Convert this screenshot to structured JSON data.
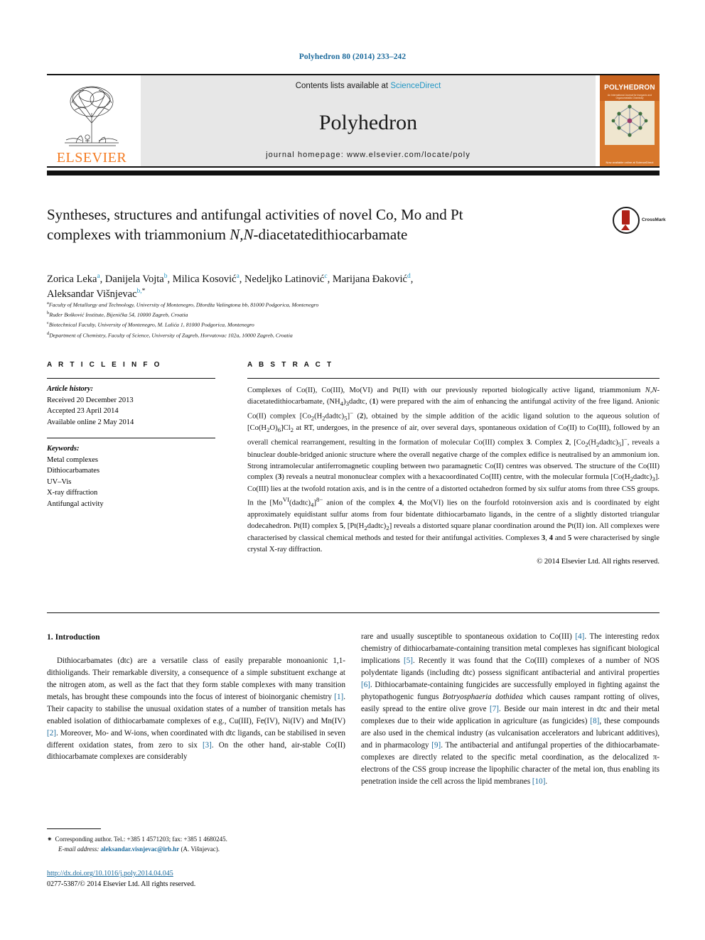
{
  "running_head": "Polyhedron 80 (2014) 233–242",
  "masthead": {
    "contents_prefix": "Contents lists available at ",
    "sciencedirect": "ScienceDirect",
    "journal_name": "Polyhedron",
    "homepage": "journal homepage: www.elsevier.com/locate/poly",
    "publisher_logo_text": "ELSEVIER",
    "cover_title": "POLYHEDRON",
    "cover_subtitle": "An International Journal for Inorganic and Organometallic Chemistry",
    "cover_footer": "Now available online at ScienceDirect"
  },
  "crossmark": {
    "label": "CrossMark"
  },
  "article": {
    "title_line1": "Syntheses, structures and antifungal activities of novel Co, Mo and Pt",
    "title_line2_pre": "complexes with triammonium ",
    "title_line2_italic": "N,N",
    "title_line2_post": "-diacetatedithiocarbamate",
    "authors": [
      {
        "name": "Zorica Leka",
        "sup": "a",
        "sep": ", "
      },
      {
        "name": "Danijela Vojta",
        "sup": "b",
        "sep": ", "
      },
      {
        "name": "Milica Kosović",
        "sup": "a",
        "sep": ", "
      },
      {
        "name": "Nedeljko Latinović",
        "sup": "c",
        "sep": ", "
      },
      {
        "name": "Marijana Đaković",
        "sup": "d",
        "sep": ","
      },
      {
        "name": "Aleksandar Višnjevac",
        "sup": "b,",
        "star": "*",
        "sep": ""
      }
    ],
    "affiliations": [
      {
        "marker": "a",
        "text": "Faculty of Metallurgy and Technology, University of Montenegro, Džordža Vašingtona bb, 81000 Podgorica, Montenegro"
      },
      {
        "marker": "b",
        "text": "Ruđer Bošković Institute, Bijenička 54, 10000 Zagreb, Croatia"
      },
      {
        "marker": "c",
        "text": "Biotechnical Faculty, University of Montenegro, M. Lalića 1, 81000 Podgorica, Montenegro"
      },
      {
        "marker": "d",
        "text": "Department of Chemistry, Faculty of Science, University of Zagreb, Horvatovac 102a, 10000 Zagreb, Croatia"
      }
    ]
  },
  "article_info": {
    "heading": "A R T I C L E  I N F O",
    "history_label": "Article history:",
    "received": "Received 20 December 2013",
    "accepted": "Accepted 23 April 2014",
    "available": "Available online 2 May 2014",
    "keywords_label": "Keywords:",
    "keywords": [
      "Metal complexes",
      "Dithiocarbamates",
      "UV–Vis",
      "X-ray diffraction",
      "Antifungal activity"
    ]
  },
  "abstract": {
    "heading": "A B S T R A C T",
    "copyright": "© 2014 Elsevier Ltd. All rights reserved."
  },
  "introduction": {
    "heading": "1. Introduction"
  },
  "footnote": {
    "star": "⁕",
    "corresponding": "Corresponding author. Tel.: +385 1 4571203; fax: +385 1 4680245.",
    "email_label": "E-mail address:",
    "email": "aleksandar.visnjevac@irb.hr",
    "email_owner": "(A. Višnjevac)."
  },
  "footer": {
    "doi": "http://dx.doi.org/10.1016/j.poly.2014.04.045",
    "issn_line": "0277-5387/© 2014 Elsevier Ltd. All rights reserved."
  },
  "colors": {
    "accent_blue": "#1b6a9c",
    "sciencedirect_blue": "#2196c4",
    "elsevier_orange": "#f47a20",
    "crossmark_red": "#b02118"
  }
}
